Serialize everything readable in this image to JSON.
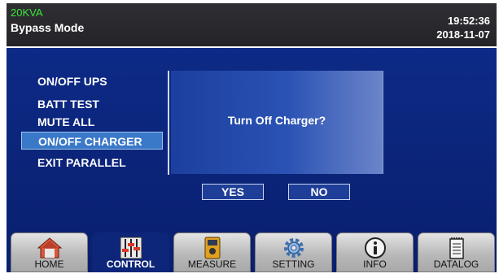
{
  "header": {
    "rating": "20KVA",
    "mode": "Bypass Mode",
    "time": "19:52:36",
    "date": "2018-11-07"
  },
  "menu": {
    "items": [
      {
        "label": "ON/OFF UPS"
      },
      {
        "label": "BATT TEST"
      },
      {
        "label": "MUTE ALL"
      },
      {
        "label": "ON/OFF CHARGER"
      },
      {
        "label": "EXIT PARALLEL"
      }
    ],
    "selected": "ON/OFF CHARGER"
  },
  "dialog": {
    "message": "Turn Off Charger?",
    "yes_label": "YES",
    "no_label": "NO"
  },
  "tabs": [
    {
      "label": "HOME",
      "icon": "home-icon"
    },
    {
      "label": "CONTROL",
      "icon": "sliders-icon"
    },
    {
      "label": "MEASURE",
      "icon": "multimeter-icon"
    },
    {
      "label": "SETTING",
      "icon": "gear-icon"
    },
    {
      "label": "INFO",
      "icon": "info-icon"
    },
    {
      "label": "DATALOG",
      "icon": "notepad-icon"
    }
  ],
  "active_tab": "CONTROL",
  "colors": {
    "header_bg": "#2a2a2e",
    "rating_text": "#39e639",
    "panel_bg": "#0b2378",
    "selected_item_bg": "#3a78c8"
  }
}
